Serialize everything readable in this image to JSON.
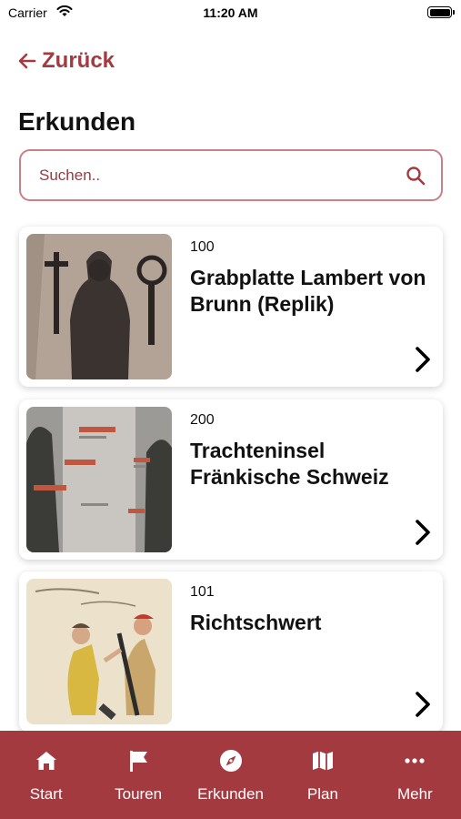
{
  "status_bar": {
    "carrier": "Carrier",
    "time": "11:20 AM"
  },
  "nav": {
    "back_label": "Zurück"
  },
  "page": {
    "title": "Erkunden"
  },
  "search": {
    "placeholder": "Suchen.."
  },
  "items": [
    {
      "number": "100",
      "title": "Grabplatte Lambert von Brunn (Replik)"
    },
    {
      "number": "200",
      "title": "Trachteninsel Fränkische Schweiz"
    },
    {
      "number": "101",
      "title": "Richtschwert"
    }
  ],
  "tabs": [
    {
      "label": "Start",
      "icon": "home-icon"
    },
    {
      "label": "Touren",
      "icon": "flag-icon"
    },
    {
      "label": "Erkunden",
      "icon": "compass-icon"
    },
    {
      "label": "Plan",
      "icon": "map-icon"
    },
    {
      "label": "Mehr",
      "icon": "more-icon"
    }
  ],
  "colors": {
    "accent": "#a33a40",
    "search_border": "#c98086",
    "text": "#111111"
  }
}
